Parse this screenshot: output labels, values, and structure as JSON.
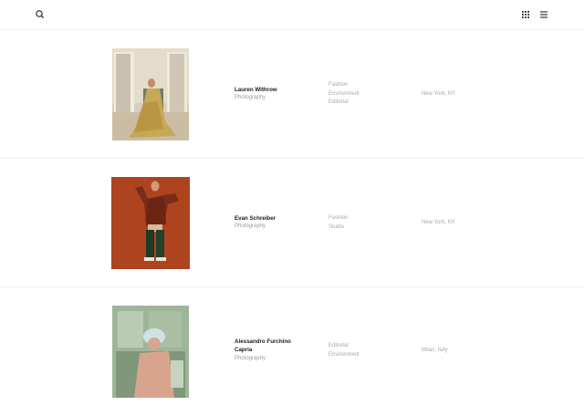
{
  "header": {
    "search_icon": "search-icon",
    "grid_icon": "grid-view-icon",
    "menu_icon": "hamburger-menu-icon"
  },
  "artists": [
    {
      "name_lines": [
        "Lauren Withrow"
      ],
      "role": "Photography",
      "tags": [
        "Fashion",
        "Environment",
        "Editorial"
      ],
      "location": "New York, NY"
    },
    {
      "name_lines": [
        "Evan Schreiber"
      ],
      "role": "Photography",
      "tags": [
        "Fashion",
        "Studio"
      ],
      "location": "New York, NY"
    },
    {
      "name_lines": [
        "Alessandro Furchino",
        "Capria"
      ],
      "role": "Photography",
      "tags": [
        "Editorial",
        "Environment"
      ],
      "location": "Milan, Italy"
    }
  ]
}
